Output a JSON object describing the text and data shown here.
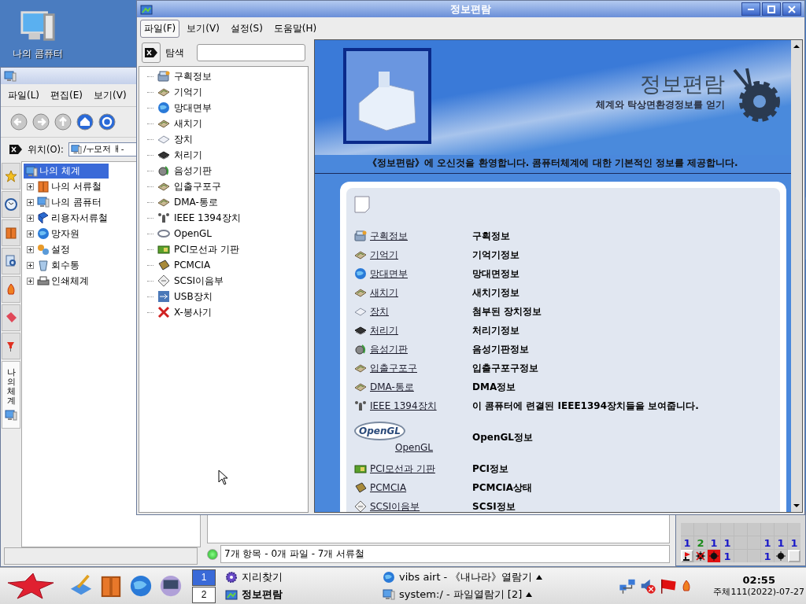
{
  "desktop_icons": [
    {
      "label": "나의 콤퓨터"
    }
  ],
  "file_manager": {
    "menu": [
      {
        "label": "파일(L)"
      },
      {
        "label": "편집(E)"
      },
      {
        "label": "보기(V)"
      }
    ],
    "toolbar": [
      {
        "kind": "back"
      },
      {
        "kind": "forward"
      },
      {
        "kind": "up"
      },
      {
        "kind": "home"
      },
      {
        "kind": "go"
      }
    ],
    "location_label": "위치(O):",
    "location_value": "/ㅜ모저 ㅐ-",
    "side_tabs": [
      {
        "kind": "star",
        "selected": false
      },
      {
        "kind": "clock",
        "selected": false
      },
      {
        "kind": "binder",
        "selected": false
      },
      {
        "kind": "search",
        "selected": false
      },
      {
        "kind": "fire",
        "selected": false
      },
      {
        "kind": "tag",
        "selected": false
      },
      {
        "kind": "pin",
        "selected": false
      },
      {
        "kind": "computer",
        "label": "나의 체계",
        "selected": true
      }
    ],
    "tree": {
      "label": "나의 체계",
      "selected": true,
      "children": [
        {
          "label": "나의 서류철",
          "kind": "binder",
          "expanded": false
        },
        {
          "label": "나의 콤퓨터",
          "kind": "computer",
          "expanded": false
        },
        {
          "label": "리용자서류철",
          "kind": "book",
          "expanded": false
        },
        {
          "label": "망자원",
          "kind": "globe",
          "expanded": false
        },
        {
          "label": "설정",
          "kind": "settings",
          "expanded": false
        },
        {
          "label": "회수통",
          "kind": "trash",
          "expanded": false
        },
        {
          "label": "인쇄체계",
          "kind": "printer",
          "expanded": false
        }
      ]
    },
    "status": "7개 항목 - 0개 파일 - 7개 서류철"
  },
  "info_center": {
    "title": "정보편람",
    "menu": [
      {
        "label": "파일(F)",
        "selected": true
      },
      {
        "label": "보기(V)",
        "selected": false
      },
      {
        "label": "설정(S)",
        "selected": false
      },
      {
        "label": "도움말(H)",
        "selected": false
      }
    ],
    "search_label": "탐색",
    "modules": [
      {
        "label": "구획정보",
        "kind": "partition"
      },
      {
        "label": "기억기",
        "kind": "chip"
      },
      {
        "label": "망대면부",
        "kind": "globe"
      },
      {
        "label": "새치기",
        "kind": "chip"
      },
      {
        "label": "장치",
        "kind": "disk"
      },
      {
        "label": "처리기",
        "kind": "cpu"
      },
      {
        "label": "음성기판",
        "kind": "sound"
      },
      {
        "label": "입출구포구",
        "kind": "chip"
      },
      {
        "label": "DMA-통로",
        "kind": "chip"
      },
      {
        "label": "IEEE 1394장치",
        "kind": "network"
      },
      {
        "label": "OpenGL",
        "kind": "opengl"
      },
      {
        "label": "PCI모선과 기판",
        "kind": "card"
      },
      {
        "label": "PCMCIA",
        "kind": "pcmcia"
      },
      {
        "label": "SCSI이음부",
        "kind": "scsi"
      },
      {
        "label": "USB장치",
        "kind": "usb"
      },
      {
        "label": "X-봉사기",
        "kind": "x"
      }
    ],
    "header_title": "정보편람",
    "header_subtitle": "체계와 탁상면환경정보를 얻기",
    "welcome": "《정보편람》에 오신것을 환영합니다. 콤퓨터체계에 대한 기본적인 정보를 제공합니다.",
    "rows": [
      {
        "link": "구획정보",
        "description": "구획정보",
        "kind": "partition"
      },
      {
        "link": "기억기",
        "description": "기억기정보",
        "kind": "chip"
      },
      {
        "link": "망대면부",
        "description": "망대면정보",
        "kind": "globe"
      },
      {
        "link": "새치기",
        "description": "새치기정보",
        "kind": "chip"
      },
      {
        "link": "장치",
        "description": "첨부된 장치정보",
        "kind": "disk"
      },
      {
        "link": "처리기",
        "description": "처리기정보",
        "kind": "cpu"
      },
      {
        "link": "음성기판",
        "description": "음성기판정보",
        "kind": "sound"
      },
      {
        "link": "입출구포구",
        "description": "입출구포구정보",
        "kind": "chip"
      },
      {
        "link": "DMA-통로",
        "description": "DMA정보",
        "kind": "chip"
      },
      {
        "link": "IEEE 1394장치",
        "description": "이 콤퓨터에 련결된 IEEE1394장치들을 보여줍니다.",
        "kind": "network"
      },
      {
        "link": "OpenGL",
        "description": "OpenGL정보",
        "kind": "logo",
        "logo_text": "OpenGL"
      },
      {
        "link": "PCI모선과 기판",
        "description": "PCI정보",
        "kind": "card"
      },
      {
        "link": "PCMCIA",
        "description": "PCMCIA상태",
        "kind": "pcmcia"
      },
      {
        "link": "SCSI이음부",
        "description": "SCSI정보",
        "kind": "scsi"
      }
    ]
  },
  "minesweeper": {
    "rows": [
      [
        {
          "kind": "empty"
        },
        {
          "kind": "empty"
        },
        {
          "kind": "empty"
        },
        {
          "kind": "empty"
        },
        {
          "kind": "empty"
        },
        {
          "kind": "empty"
        },
        {
          "kind": "empty"
        },
        {
          "kind": "empty"
        },
        {
          "kind": "empty"
        }
      ],
      [
        {
          "kind": "number",
          "text": "1",
          "color": "#1818c8"
        },
        {
          "kind": "number",
          "text": "2",
          "color": "#1a8a1a"
        },
        {
          "kind": "number",
          "text": "1",
          "color": "#1818c8"
        },
        {
          "kind": "number",
          "text": "1",
          "color": "#1818c8"
        },
        {
          "kind": "empty"
        },
        {
          "kind": "empty"
        },
        {
          "kind": "number",
          "text": "1",
          "color": "#1818c8"
        },
        {
          "kind": "number",
          "text": "1",
          "color": "#1818c8"
        },
        {
          "kind": "number",
          "text": "1",
          "color": "#1818c8"
        }
      ],
      [
        {
          "kind": "flag"
        },
        {
          "kind": "wrong_mine"
        },
        {
          "kind": "exploded"
        },
        {
          "kind": "number",
          "text": "1",
          "color": "#1818c8"
        },
        {
          "kind": "empty"
        },
        {
          "kind": "empty"
        },
        {
          "kind": "number",
          "text": "1",
          "color": "#1818c8"
        },
        {
          "kind": "mine"
        },
        {
          "kind": "hidden"
        }
      ]
    ]
  },
  "taskbar": {
    "launchers": [
      {
        "kind": "notes"
      },
      {
        "kind": "binder"
      },
      {
        "kind": "globe"
      },
      {
        "kind": "media"
      }
    ],
    "desktops": [
      {
        "label": "1",
        "selected": true
      },
      {
        "label": "2",
        "selected": false
      }
    ],
    "tasks": [
      {
        "label": "지리찾기",
        "kind": "gear",
        "active": false,
        "grouped": false
      },
      {
        "label": "정보편람",
        "kind": "info",
        "active": true,
        "grouped": false
      },
      {
        "label": "vibs airt - 《내나라》열람기",
        "kind": "globe",
        "active": false,
        "grouped": true
      },
      {
        "label": "system:/ - 파일열람기 [2]",
        "kind": "computer",
        "active": false,
        "grouped": true
      }
    ],
    "tray": [
      {
        "kind": "network"
      },
      {
        "kind": "volume_muted"
      },
      {
        "kind": "flag"
      },
      {
        "kind": "fire"
      }
    ],
    "time": "02:55",
    "date": "주체111(2022)-07-27"
  }
}
